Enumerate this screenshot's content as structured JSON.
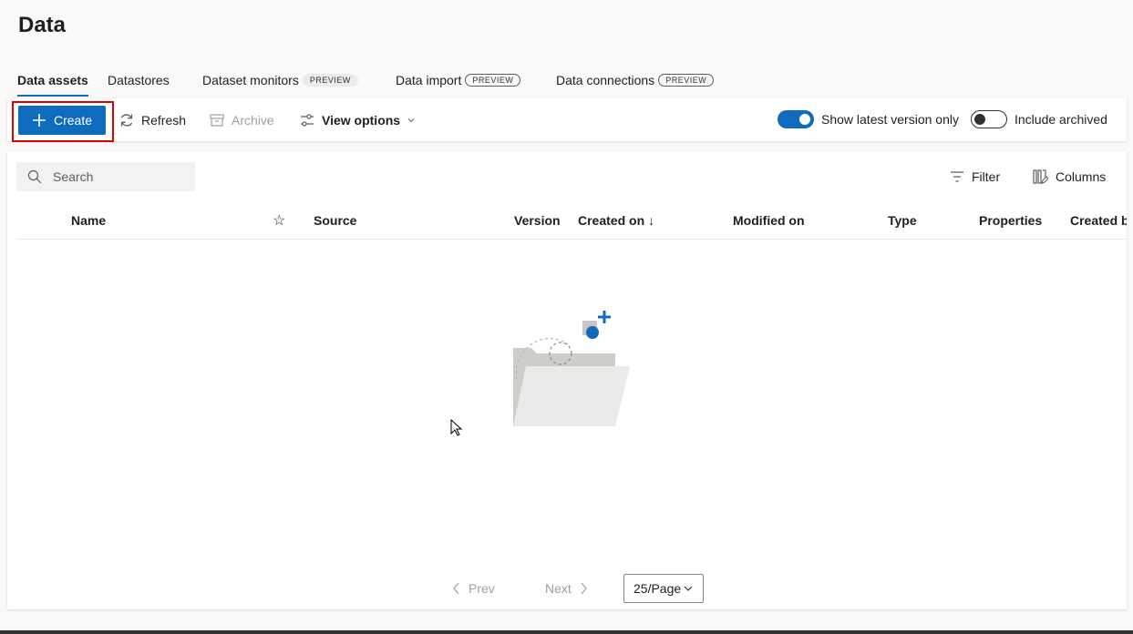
{
  "page": {
    "title": "Data"
  },
  "tabs": [
    {
      "label": "Data assets",
      "active": true,
      "badge": ""
    },
    {
      "label": "Datastores",
      "active": false,
      "badge": ""
    },
    {
      "label": "Dataset monitors",
      "active": false,
      "badge": "PREVIEW"
    },
    {
      "label": "Data import",
      "active": false,
      "badge": "PREVIEW"
    },
    {
      "label": "Data connections",
      "active": false,
      "badge": "PREVIEW"
    }
  ],
  "toolbar": {
    "create_label": "Create",
    "refresh_label": "Refresh",
    "archive_label": "Archive",
    "view_options_label": "View options",
    "show_latest_label": "Show latest version only",
    "show_latest_on": true,
    "include_archived_label": "Include archived",
    "include_archived_on": false
  },
  "list": {
    "search_placeholder": "Search",
    "filter_label": "Filter",
    "columns_label": "Columns",
    "columns": [
      "Name",
      "☆",
      "Source",
      "Version",
      "Created on ↓",
      "Modified on",
      "Type",
      "Properties",
      "Created by"
    ],
    "rows": []
  },
  "pagination": {
    "prev_label": "Prev",
    "next_label": "Next",
    "page_size": "25/Page"
  },
  "colors": {
    "accent": "#0f6cbd",
    "highlight": "#e00000"
  }
}
